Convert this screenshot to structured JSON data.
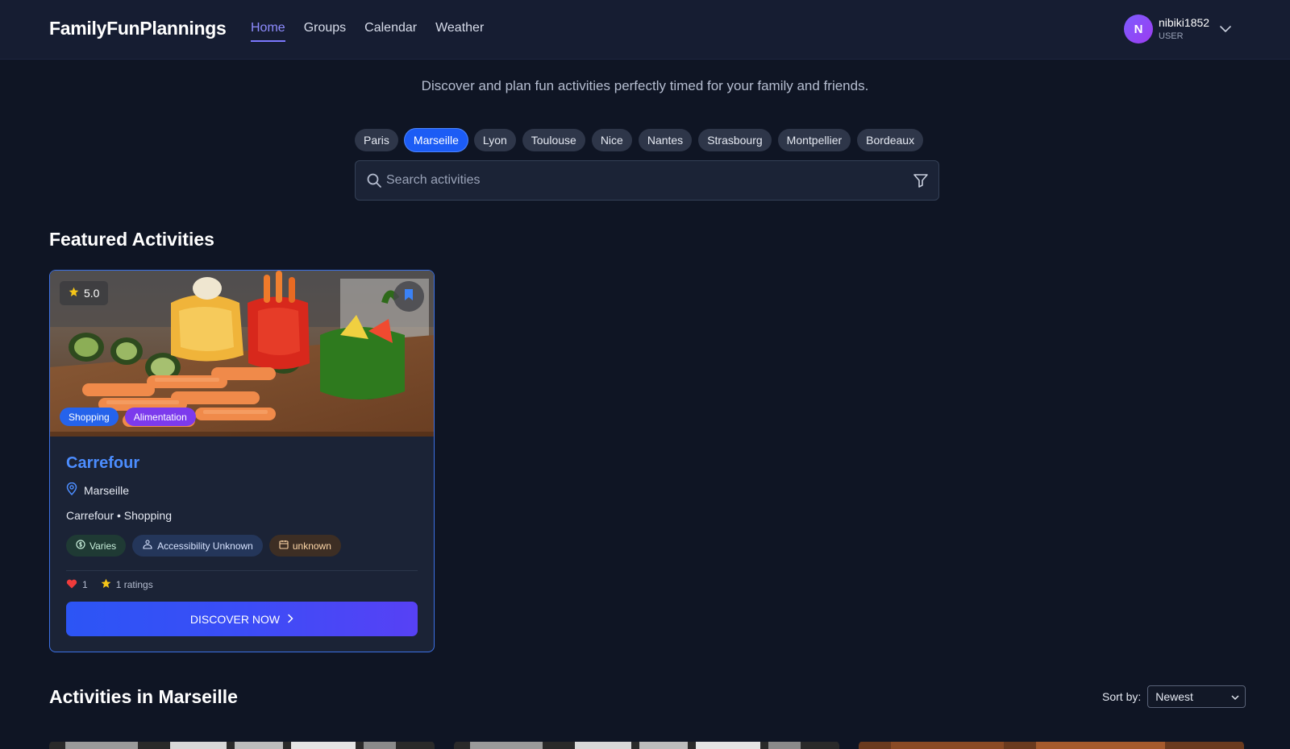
{
  "header": {
    "brand": "FamilyFunPlannings",
    "nav": [
      "Home",
      "Groups",
      "Calendar",
      "Weather"
    ],
    "active_nav": "Home",
    "user": {
      "initial": "N",
      "name": "nibiki1852",
      "role": "USER"
    }
  },
  "hero": {
    "subtitle": "Discover and plan fun activities perfectly timed for your family and friends."
  },
  "cities": {
    "items": [
      "Paris",
      "Marseille",
      "Lyon",
      "Toulouse",
      "Nice",
      "Nantes",
      "Strasbourg",
      "Montpellier",
      "Bordeaux"
    ],
    "selected": "Marseille"
  },
  "search": {
    "placeholder": "Search activities",
    "value": ""
  },
  "featured": {
    "heading": "Featured Activities",
    "card": {
      "rating": "5.0",
      "tags": [
        "Shopping",
        "Alimentation"
      ],
      "title": "Carrefour",
      "location": "Marseille",
      "description": "Carrefour • Shopping",
      "pills": {
        "price": "Varies",
        "accessibility": "Accessibility Unknown",
        "schedule": "unknown"
      },
      "likes": "1",
      "ratings": "1 ratings",
      "cta": "DISCOVER NOW"
    }
  },
  "city_section": {
    "heading": "Activities in Marseille",
    "sort_label": "Sort by:",
    "sort_value": "Newest"
  },
  "colors": {
    "background": "#0f1524",
    "accent": "#1c5cf5",
    "title_link": "#4c8dff",
    "active_nav": "#8e8cff"
  }
}
